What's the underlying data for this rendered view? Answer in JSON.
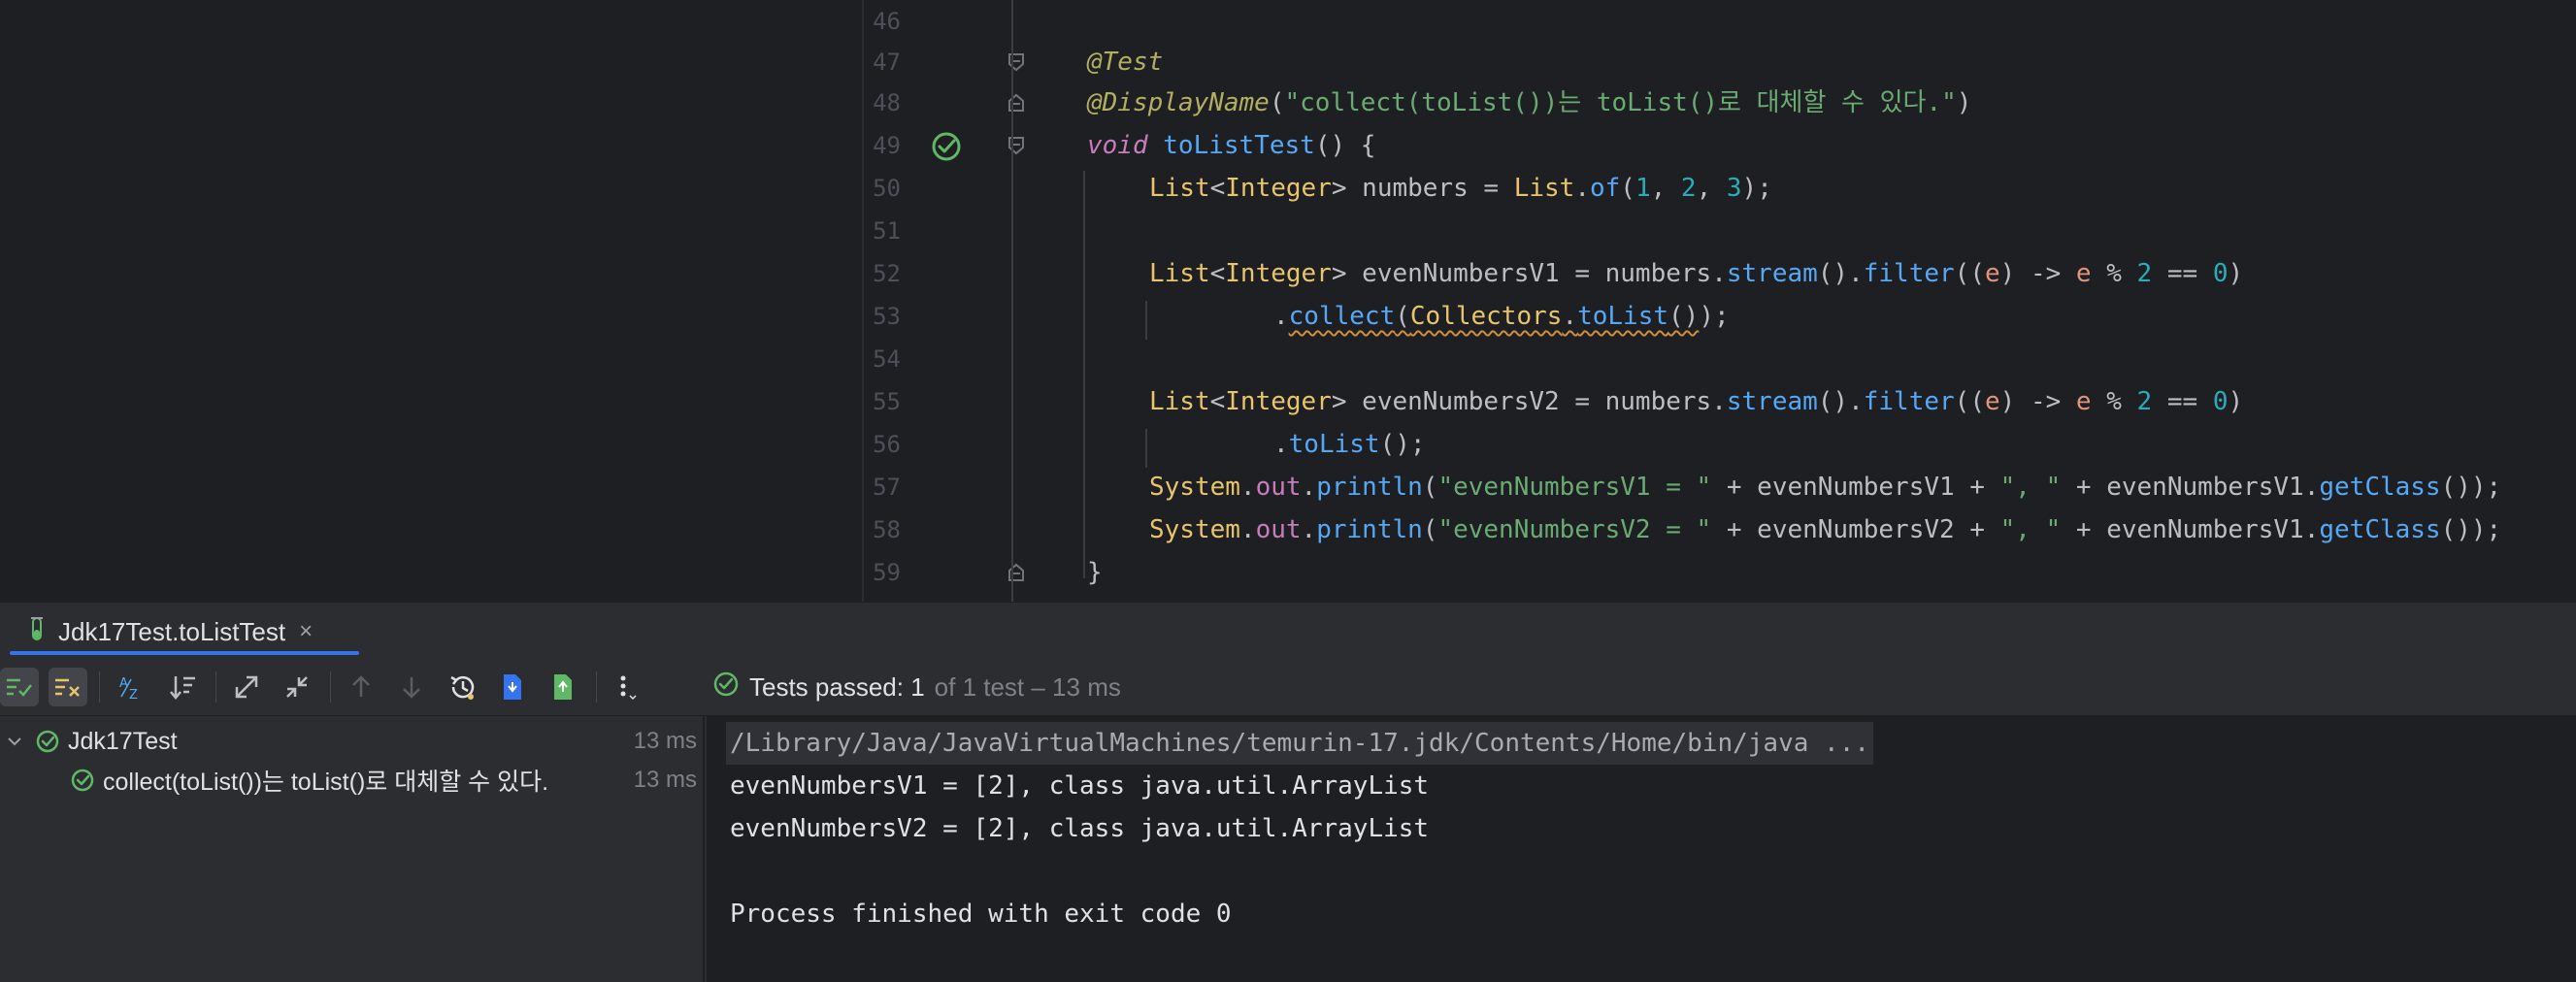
{
  "editor": {
    "line_numbers": [
      "46",
      "47",
      "48",
      "49",
      "50",
      "51",
      "52",
      "53",
      "54",
      "55",
      "56",
      "57",
      "58",
      "59"
    ],
    "code": {
      "l47_annotation": "@Test",
      "l48_annotation": "@DisplayName",
      "l48_open": "(",
      "l48_string": "\"collect(toList())는 toList()로 대체할 수 있다.\"",
      "l48_close": ")",
      "l49_void": "void",
      "l49_space": " ",
      "l49_name": "toListTest",
      "l49_rest": "() {",
      "l50": {
        "t1": "List",
        "t2": "<",
        "t3": "Integer",
        "t4": "> numbers = ",
        "t5": "List",
        "t6": ".",
        "t7": "of",
        "t8": "(",
        "n1": "1",
        "c1": ", ",
        "n2": "2",
        "c2": ", ",
        "n3": "3",
        "end": ");"
      },
      "l52": {
        "t1": "List",
        "t2": "<",
        "t3": "Integer",
        "t4": "> evenNumbersV1 = numbers.",
        "m1": "stream",
        "p1": "().",
        "m2": "filter",
        "p2": "((",
        "e1": "e",
        "p3": ") -> ",
        "e2": "e",
        "op": " % ",
        "n1": "2",
        "eq": " == ",
        "n2": "0",
        "end": ")"
      },
      "l53": {
        "dot": ".",
        "m1": "collect",
        "p1": "(",
        "cls": "Collectors",
        "dot2": ".",
        "m2": "toList",
        "p2": "()",
        "end": ");"
      },
      "l55": {
        "t1": "List",
        "t2": "<",
        "t3": "Integer",
        "t4": "> evenNumbersV2 = numbers.",
        "m1": "stream",
        "p1": "().",
        "m2": "filter",
        "p2": "((",
        "e1": "e",
        "p3": ") -> ",
        "e2": "e",
        "op": " % ",
        "n1": "2",
        "eq": " == ",
        "n2": "0",
        "end": ")"
      },
      "l56": {
        "dot": ".",
        "m1": "toList",
        "end": "();"
      },
      "l57": {
        "cls": "System",
        "dot": ".",
        "fld": "out",
        "dot2": ".",
        "m1": "println",
        "p1": "(",
        "s1": "\"evenNumbersV1 = \"",
        "plus1": " + evenNumbersV1 + ",
        "s2": "\", \"",
        "plus2": " + evenNumbersV1.",
        "m2": "getClass",
        "end": "());"
      },
      "l58": {
        "cls": "System",
        "dot": ".",
        "fld": "out",
        "dot2": ".",
        "m1": "println",
        "p1": "(",
        "s1": "\"evenNumbersV2 = \"",
        "plus1": " + evenNumbersV2 + ",
        "s2": "\", \"",
        "plus2": " + evenNumbersV1.",
        "m2": "getClass",
        "end": "());"
      },
      "l59": "}"
    }
  },
  "run_tab": {
    "label": "Jdk17Test.toListTest",
    "close": "×"
  },
  "status": {
    "passed": "Tests passed: 1",
    "rest": "of 1 test – 13 ms"
  },
  "tree": {
    "root": {
      "label": "Jdk17Test",
      "time": "13 ms"
    },
    "child": {
      "label": "collect(toList())는 toList()로 대체할 수 있다.",
      "time": "13 ms"
    }
  },
  "console": {
    "command": "/Library/Java/JavaVirtualMachines/temurin-17.jdk/Contents/Home/bin/java ...",
    "line1": "evenNumbersV1 = [2], class java.util.ArrayList",
    "line2": "evenNumbersV2 = [2], class java.util.ArrayList",
    "line3": "Process finished with exit code 0"
  },
  "colors": {
    "pass": "#5fb865",
    "accent": "#3574f0",
    "background": "#1e1f22",
    "panel": "#2b2d30"
  },
  "icons": [
    "pass-check-icon",
    "fold-icon",
    "test-tube-icon",
    "close-icon",
    "show-passed-icon",
    "show-ignored-icon",
    "sort-alpha-icon",
    "sort-duration-icon",
    "expand-all-icon",
    "collapse-all-icon",
    "prev-failed-icon",
    "next-failed-icon",
    "history-icon",
    "import-tests-icon",
    "export-tests-icon",
    "more-options-icon"
  ]
}
